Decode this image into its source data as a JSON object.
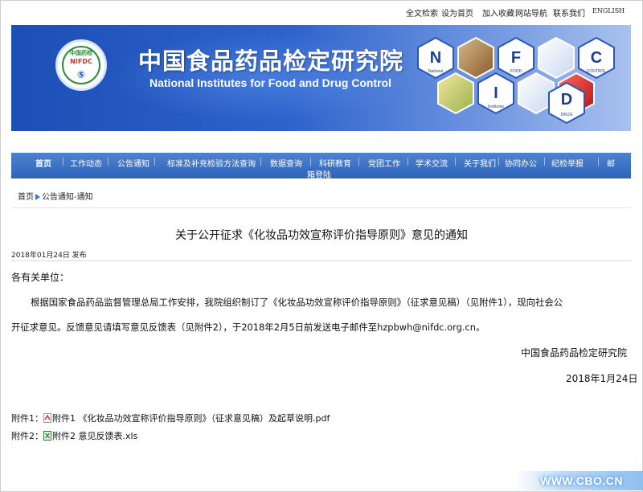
{
  "top_links": {
    "search": "全文检索",
    "homepage": "设为首页",
    "favorite": "加入收藏",
    "sitemap": "网站导航",
    "contact": "联系我们",
    "english": "ENGLISH"
  },
  "header": {
    "logo_text_top": "中国药检",
    "logo_text_mid": "NIFDC",
    "title_cn": "中国食品药品检定研究院",
    "title_en": "National Institutes for Food and Drug Control",
    "hex_letters": {
      "n": "N",
      "i": "I",
      "f": "F",
      "d": "D",
      "c": "C"
    },
    "hex_labels": {
      "n": "National",
      "i": "Institutes",
      "f": "FOOD",
      "d": "DRUG",
      "c": "CONTROL"
    }
  },
  "nav": {
    "items": [
      "首页",
      "工作动态",
      "公告通知",
      "标准及补充检验方法查询",
      "数据查询",
      "科研教育",
      "党团工作",
      "学术交流",
      "关于我们",
      "协同办公",
      "纪检举报",
      "邮"
    ],
    "overflow": "箱登陆"
  },
  "breadcrumb": {
    "home": "首页",
    "section": "公告通知-通知"
  },
  "article": {
    "title": "关于公开征求《化妆品功效宣称评价指导原则》意见的通知",
    "publish_line": "2018年01月24日 发布",
    "salutation": "各有关单位：",
    "body_line1": "根据国家食品药品监督管理总局工作安排，我院组织制订了《化妆品功效宣称评价指导原则》（征求意见稿）（见附件1），现向社会公",
    "body_line2": "开征求意见。反馈意见请填写意见反馈表（见附件2），于2018年2月5日前发送电子邮件至hzpbwh@nifdc.org.cn。",
    "signature": "中国食品药品检定研究院",
    "date": "2018年1月24日",
    "attachments": [
      {
        "label": "附件1：",
        "file": "附件1 《化妆品功效宣称评价指导原则》（征求意见稿）及起草说明.pdf",
        "icon": "pdf-icon"
      },
      {
        "label": "附件2：",
        "file": "附件2 意见反馈表.xls",
        "icon": "excel-icon"
      }
    ]
  },
  "watermark": "WWW.CBO.CN"
}
